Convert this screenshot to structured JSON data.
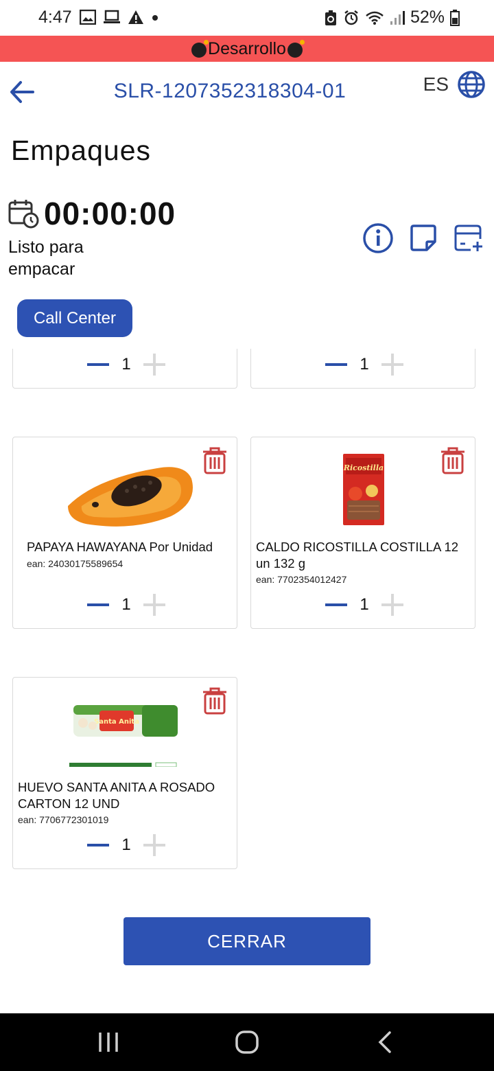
{
  "status_bar": {
    "time": "4:47",
    "battery": "52%"
  },
  "env_banner": {
    "label": "Desarrollo"
  },
  "header": {
    "title": "SLR-1207352318304-01",
    "language": "ES"
  },
  "page": {
    "title": "Empaques",
    "timer": "00:00:00",
    "status": "Listo para empacar",
    "call_center_label": "Call Center"
  },
  "products": [
    {
      "name": "",
      "ean": "",
      "qty": "1",
      "partial": true
    },
    {
      "name": "",
      "ean": "",
      "qty": "1",
      "partial": true
    },
    {
      "name": "PAPAYA HAWAYANA Por Unidad",
      "ean": "ean: 24030175589654",
      "qty": "1"
    },
    {
      "name": "CALDO RICOSTILLA COSTILLA 12 un 132 g",
      "ean": "ean: 7702354012427",
      "qty": "1",
      "image_text": "Ricostilla"
    },
    {
      "name": "HUEVO SANTA ANITA A ROSADO CARTON 12 UND",
      "ean": "ean: 7706772301019",
      "qty": "1",
      "image_text": "Santa Anita"
    }
  ],
  "footer": {
    "close_label": "CERRAR"
  },
  "colors": {
    "primary": "#2d52b3",
    "title_blue": "#2a4fa8",
    "danger": "#c94040",
    "banner": "#f55454"
  }
}
